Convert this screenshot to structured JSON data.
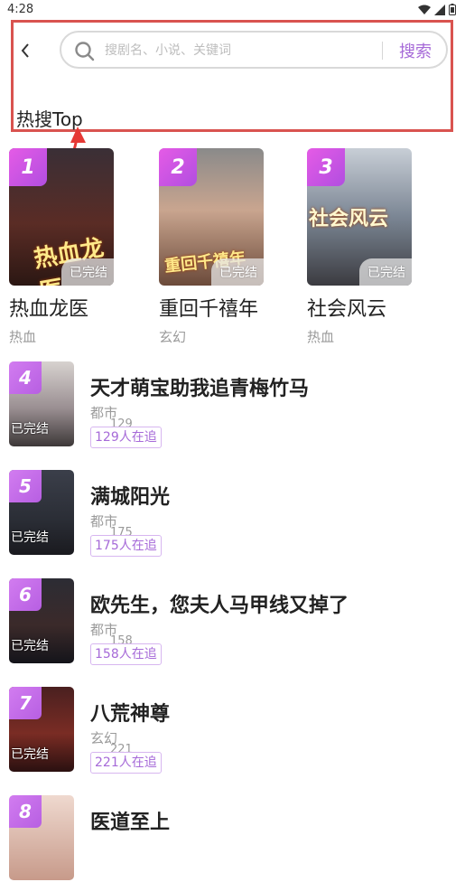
{
  "status_bar": {
    "time": "4:28"
  },
  "search": {
    "placeholder": "搜剧名、小说、关键词",
    "button_label": "搜索"
  },
  "section_title": "热搜Top",
  "done_label": "已完结",
  "top_items": [
    {
      "rank": "1",
      "title": "热血龙医",
      "genre": "热血",
      "cover_text": "热血龙医"
    },
    {
      "rank": "2",
      "title": "重回千禧年",
      "genre": "玄幻",
      "cover_text": "重回千禧年"
    },
    {
      "rank": "3",
      "title": "社会风云",
      "genre": "热血",
      "cover_text": "社会风云"
    }
  ],
  "list_items": [
    {
      "rank": "4",
      "title": "天才萌宝助我追青梅竹马",
      "genre": "都市",
      "count": "129",
      "follow": "129人在追"
    },
    {
      "rank": "5",
      "title": "满城阳光",
      "genre": "都市",
      "count": "175",
      "follow": "175人在追"
    },
    {
      "rank": "6",
      "title": "欧先生，您夫人马甲线又掉了",
      "genre": "都市",
      "count": "158",
      "follow": "158人在追"
    },
    {
      "rank": "7",
      "title": "八荒神尊",
      "genre": "玄幻",
      "count": "221",
      "follow": "221人在追"
    },
    {
      "rank": "8",
      "title": "医道至上",
      "genre": "",
      "count": "",
      "follow": ""
    }
  ],
  "colors": {
    "accent": "#a66ad8",
    "badge": "#c35ee3",
    "highlight": "#d9534f"
  }
}
